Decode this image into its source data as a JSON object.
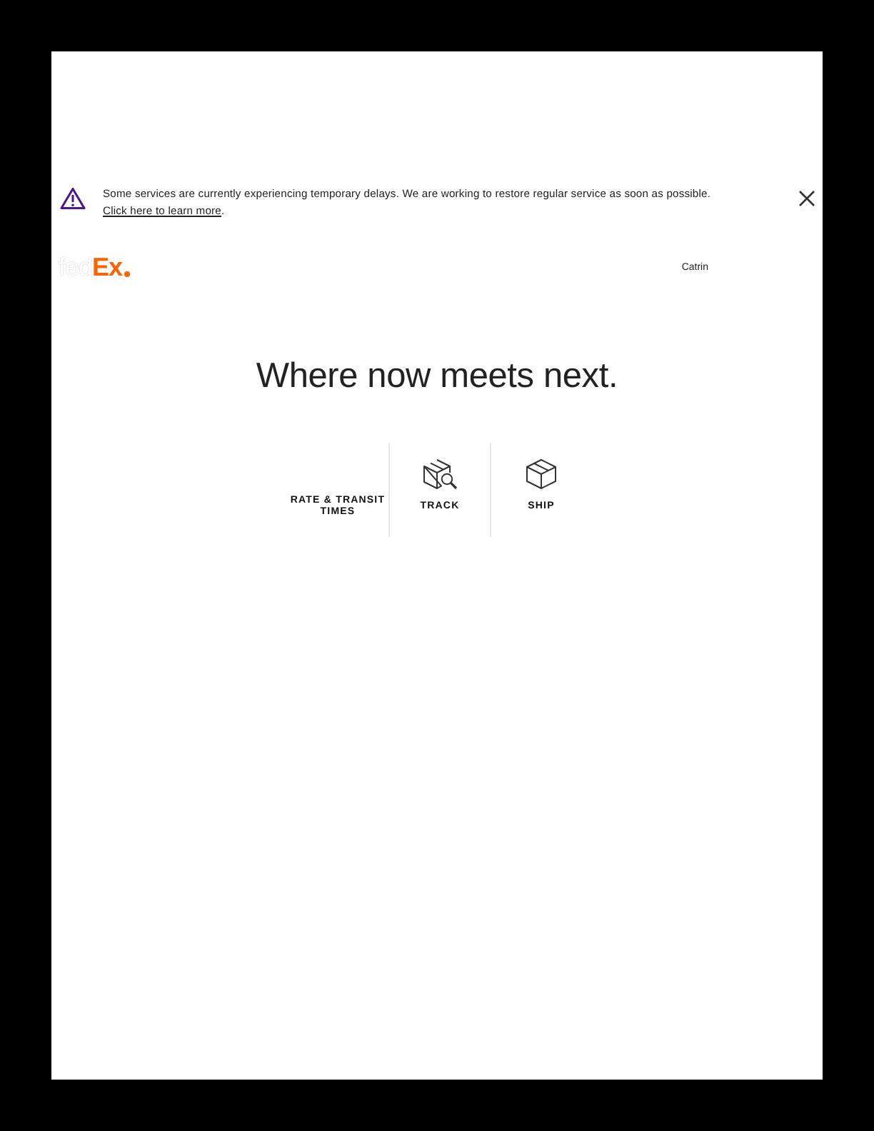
{
  "alert": {
    "text_before": "Some services are currently experiencing temporary delays. We are working to restore regular service as soon as possible. ",
    "link": "Click here to learn more",
    "text_after": "."
  },
  "header": {
    "logo": {
      "parts": [
        {
          "text": "fed",
          "color": "#ffffff"
        },
        {
          "text": "Ex",
          "color": "#ff6200"
        }
      ]
    },
    "user_name": "Catrin"
  },
  "hero": {
    "headline": "Where now meets next."
  },
  "tabs": [
    {
      "label": "RATE & TRANSIT TIMES",
      "kind": "text"
    },
    {
      "label": "TRACK",
      "kind": "search"
    },
    {
      "label": "SHIP",
      "kind": "parcel"
    }
  ]
}
